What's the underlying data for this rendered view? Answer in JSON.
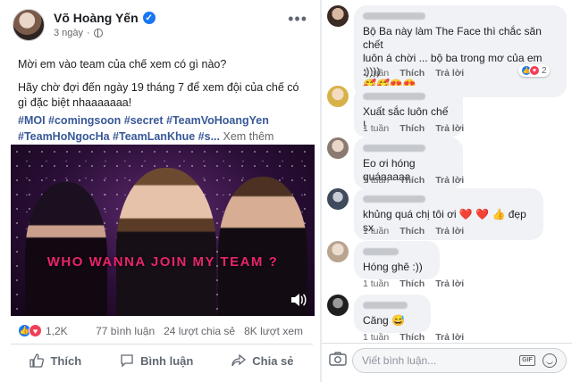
{
  "post": {
    "author": "Võ Hoàng Yến",
    "time": "3 ngày",
    "paragraphs": [
      "Mời em vào team của chế xem có gì nào?",
      "Hãy chờ đợi đến ngày 19 tháng 7 để xem đội của chế có gì đặc biệt nhaaaaaaa!"
    ],
    "hashtags_line1": "#MOI #comingsoon #secret #TeamVoHoangYen",
    "hashtags_line2": "#TeamHoNgocHa #TeamLanKhue #s...",
    "see_more": "Xem thêm",
    "media_text": "WHO WANNA JOIN MY TEAM ?",
    "reaction_count": "1,2K",
    "comments_count": "77 bình luận",
    "shares_count": "24 lượt chia sẻ",
    "views_count": "8K lượt xem",
    "actions": {
      "like": "Thích",
      "comment": "Bình luận",
      "share": "Chia sẻ"
    }
  },
  "comments": [
    {
      "text_line1": "Bộ Ba này làm The Face thì chắc săn chết",
      "text_line2": "luôn á chời ... bộ ba trong mơ của em :))))",
      "emojis": "🥰🥰😍😍",
      "time": "1 tuần",
      "like": "Thích",
      "reply": "Trả lời",
      "reaction_count": "2"
    },
    {
      "text": "Xuất sắc luôn chế !",
      "time": "1 tuần",
      "like": "Thích",
      "reply": "Trả lời"
    },
    {
      "text": "Eo ơi hóng quáaaaaa",
      "time": "1 tuần",
      "like": "Thích",
      "reply": "Trả lời"
    },
    {
      "text": "khủng quá chị tôi ơi ❤️ ❤️ 👍 đẹp sx",
      "time": "1 tuần",
      "like": "Thích",
      "reply": "Trả lời"
    },
    {
      "text": "Hóng ghê :))",
      "time": "1 tuần",
      "like": "Thích",
      "reply": "Trả lời"
    },
    {
      "text": "Căng 😅",
      "time": "1 tuần",
      "like": "Thích",
      "reply": "Trả lời"
    }
  ],
  "composer": {
    "placeholder": "Viết bình luận...",
    "gif": "GIF"
  },
  "icons": {
    "verified": "verified-badge-icon",
    "privacy": "globe-icon",
    "more": "more-options-icon",
    "volume": "volume-icon",
    "camera": "camera-icon",
    "sticker": "sticker-icon"
  },
  "colors": {
    "link_blue": "#385898",
    "facebook_blue": "#1877f2",
    "love_red": "#f33e58",
    "media_text_pink": "#e8246a"
  }
}
